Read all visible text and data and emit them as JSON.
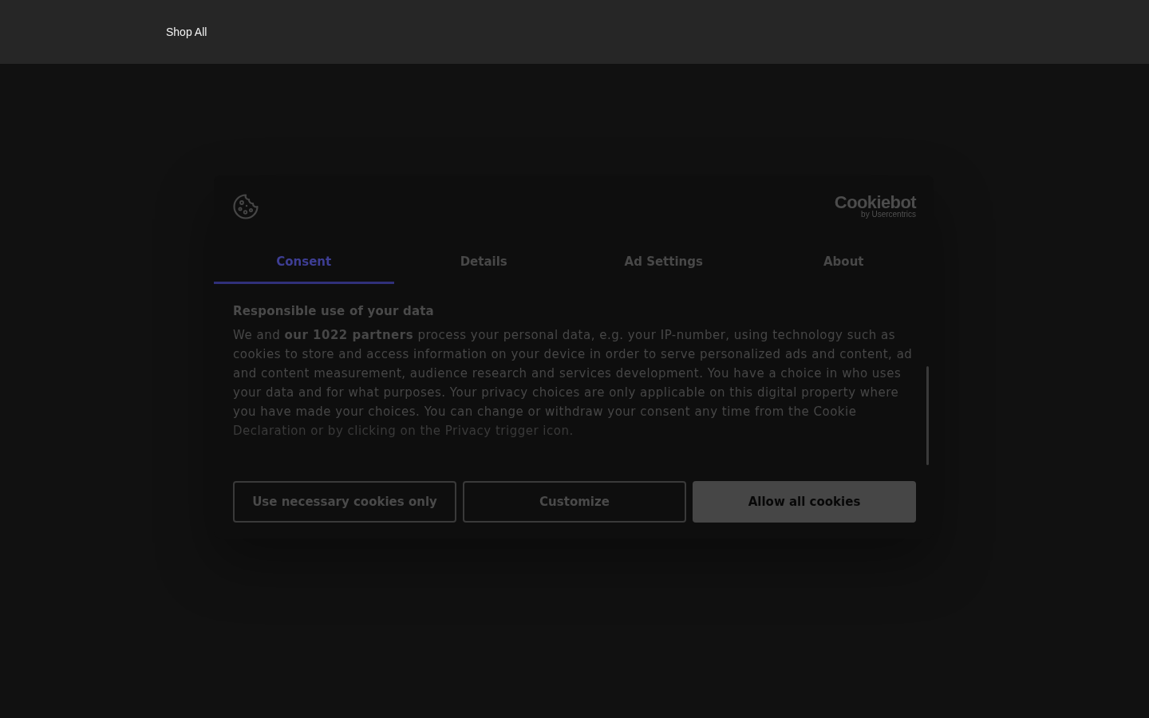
{
  "header": {
    "nav_items": [
      {
        "label": "Shop All"
      }
    ]
  },
  "consent_dialog": {
    "logo": {
      "name": "Cookiebot",
      "tagline": "by Usercentrics"
    },
    "tabs": [
      {
        "label": "Consent",
        "selected": true
      },
      {
        "label": "Details",
        "selected": false
      },
      {
        "label": "Ad Settings",
        "selected": false
      },
      {
        "label": "About",
        "selected": false
      }
    ],
    "heading": "Responsible use of your data",
    "body": "We and **our 1022 partners** process your personal data, e.g. your IP-number, using technology such as cookies to store and access information on your device in order to serve personalized ads and content, ad and content measurement, audience research and services development. You have a choice in who uses your data and for what purposes. Your privacy choices are only applicable on this digital property where you have made your choices. You can change or withdraw your consent any time from the Cookie Declaration or by clicking on the Privacy trigger icon.",
    "buttons": [
      {
        "label": "Use necessary cookies only",
        "kind": "outline"
      },
      {
        "label": "Customize",
        "kind": "outline"
      },
      {
        "label": "Allow all cookies",
        "kind": "filled"
      }
    ]
  }
}
